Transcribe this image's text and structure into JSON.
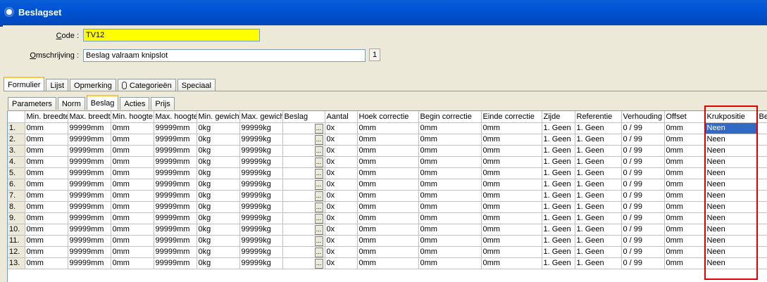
{
  "window": {
    "title": "Beslagset"
  },
  "form": {
    "code_label_prefix": "",
    "code_label_ul": "C",
    "code_label_rest": "ode :",
    "code_value": "TV12",
    "omschrijving_label_ul": "O",
    "omschrijving_label_rest": "mschrijving :",
    "omschrijving_value": "Beslag valraam knipslot",
    "counter": "1"
  },
  "main_tabs": [
    "Formulier",
    "Lijst",
    "Opmerking",
    "Categorieën",
    "Speciaal"
  ],
  "sub_tabs": [
    "Parameters",
    "Norm",
    "Beslag",
    "Acties",
    "Prijs"
  ],
  "grid": {
    "columns": [
      "",
      "Min. breedte",
      "Max. breedte",
      "Min. hoogte",
      "Max. hoogte",
      "Min. gewicht",
      "Max. gewicht",
      "Beslag",
      "Aantal",
      "Hoek correctie",
      "Begin correctie",
      "Einde correctie",
      "Zijde",
      "Referentie",
      "Verhouding",
      "Offset",
      "Krukpositie",
      "Be"
    ],
    "ellipsis": "...",
    "rows": [
      [
        "1.",
        "0mm",
        "99999mm",
        "0mm",
        "99999mm",
        "0kg",
        "99999kg",
        "",
        "0x",
        "0mm",
        "0mm",
        "0mm",
        "1. Geen",
        "1. Geen",
        "0 / 99",
        "0mm",
        "Neen",
        ""
      ],
      [
        "2.",
        "0mm",
        "99999mm",
        "0mm",
        "99999mm",
        "0kg",
        "99999kg",
        "",
        "0x",
        "0mm",
        "0mm",
        "0mm",
        "1. Geen",
        "1. Geen",
        "0 / 99",
        "0mm",
        "Neen",
        ""
      ],
      [
        "3.",
        "0mm",
        "99999mm",
        "0mm",
        "99999mm",
        "0kg",
        "99999kg",
        "",
        "0x",
        "0mm",
        "0mm",
        "0mm",
        "1. Geen",
        "1. Geen",
        "0 / 99",
        "0mm",
        "Neen",
        ""
      ],
      [
        "4.",
        "0mm",
        "99999mm",
        "0mm",
        "99999mm",
        "0kg",
        "99999kg",
        "",
        "0x",
        "0mm",
        "0mm",
        "0mm",
        "1. Geen",
        "1. Geen",
        "0 / 99",
        "0mm",
        "Neen",
        ""
      ],
      [
        "5.",
        "0mm",
        "99999mm",
        "0mm",
        "99999mm",
        "0kg",
        "99999kg",
        "",
        "0x",
        "0mm",
        "0mm",
        "0mm",
        "1. Geen",
        "1. Geen",
        "0 / 99",
        "0mm",
        "Neen",
        ""
      ],
      [
        "6.",
        "0mm",
        "99999mm",
        "0mm",
        "99999mm",
        "0kg",
        "99999kg",
        "",
        "0x",
        "0mm",
        "0mm",
        "0mm",
        "1. Geen",
        "1. Geen",
        "0 / 99",
        "0mm",
        "Neen",
        ""
      ],
      [
        "7.",
        "0mm",
        "99999mm",
        "0mm",
        "99999mm",
        "0kg",
        "99999kg",
        "",
        "0x",
        "0mm",
        "0mm",
        "0mm",
        "1. Geen",
        "1. Geen",
        "0 / 99",
        "0mm",
        "Neen",
        ""
      ],
      [
        "8.",
        "0mm",
        "99999mm",
        "0mm",
        "99999mm",
        "0kg",
        "99999kg",
        "",
        "0x",
        "0mm",
        "0mm",
        "0mm",
        "1. Geen",
        "1. Geen",
        "0 / 99",
        "0mm",
        "Neen",
        ""
      ],
      [
        "9.",
        "0mm",
        "99999mm",
        "0mm",
        "99999mm",
        "0kg",
        "99999kg",
        "",
        "0x",
        "0mm",
        "0mm",
        "0mm",
        "1. Geen",
        "1. Geen",
        "0 / 99",
        "0mm",
        "Neen",
        ""
      ],
      [
        "10.",
        "0mm",
        "99999mm",
        "0mm",
        "99999mm",
        "0kg",
        "99999kg",
        "",
        "0x",
        "0mm",
        "0mm",
        "0mm",
        "1. Geen",
        "1. Geen",
        "0 / 99",
        "0mm",
        "Neen",
        ""
      ],
      [
        "11.",
        "0mm",
        "99999mm",
        "0mm",
        "99999mm",
        "0kg",
        "99999kg",
        "",
        "0x",
        "0mm",
        "0mm",
        "0mm",
        "1. Geen",
        "1. Geen",
        "0 / 99",
        "0mm",
        "Neen",
        ""
      ],
      [
        "12.",
        "0mm",
        "99999mm",
        "0mm",
        "99999mm",
        "0kg",
        "99999kg",
        "",
        "0x",
        "0mm",
        "0mm",
        "0mm",
        "1. Geen",
        "1. Geen",
        "0 / 99",
        "0mm",
        "Neen",
        ""
      ],
      [
        "13.",
        "0mm",
        "99999mm",
        "0mm",
        "99999mm",
        "0kg",
        "99999kg",
        "",
        "0x",
        "0mm",
        "0mm",
        "0mm",
        "1. Geen",
        "1. Geen",
        "0 / 99",
        "0mm",
        "Neen",
        ""
      ]
    ]
  },
  "colors": {
    "code_field_bg": "#ffff00",
    "selection": "#316ac5",
    "highlight_box": "#e00000",
    "titlebar": "#0052d4"
  }
}
